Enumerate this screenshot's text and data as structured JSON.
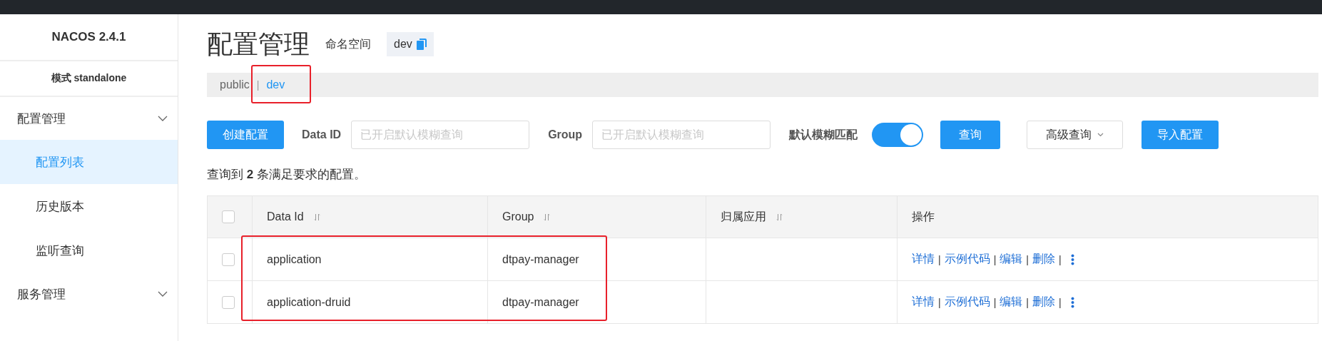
{
  "sidebar": {
    "title": "NACOS 2.4.1",
    "mode": "模式 standalone",
    "items": [
      {
        "label": "配置管理",
        "kind": "group",
        "children": [
          {
            "label": "配置列表",
            "selected": true
          },
          {
            "label": "历史版本",
            "selected": false
          },
          {
            "label": "监听查询",
            "selected": false
          }
        ]
      },
      {
        "label": "服务管理",
        "kind": "group"
      }
    ]
  },
  "header": {
    "title": "配置管理",
    "namespace_label": "命名空间",
    "namespace_value": "dev",
    "namespaces": [
      {
        "kind": "namespace",
        "text": "public",
        "selected": false
      },
      {
        "kind": "separator",
        "text": "|"
      },
      {
        "kind": "namespace",
        "text": "dev",
        "selected": true
      }
    ]
  },
  "toolbar": {
    "create_button": "创建配置",
    "data_id_label": "Data ID",
    "data_id_placeholder": "已开启默认模糊查询",
    "group_label": "Group",
    "group_placeholder": "已开启默认模糊查询",
    "fuzzy_label": "默认模糊匹配",
    "fuzzy_on": true,
    "query_button": "查询",
    "advanced_button": "高级查询",
    "import_button": "导入配置"
  },
  "summary": "查询到 **2** 条满足要求的配置。",
  "table": {
    "select_all_checked": false,
    "columns": [
      {
        "label": "Data Id",
        "sortable": true
      },
      {
        "label": "Group",
        "sortable": true
      },
      {
        "label": "归属应用",
        "sortable": true
      },
      {
        "label": "操作",
        "sortable": false
      }
    ],
    "rows": [
      {
        "checked": false,
        "data_id": "application",
        "group": "dtpay-manager",
        "actions": [
          {
            "kind": "link",
            "text": "详情"
          },
          {
            "kind": "separator",
            "text": "|"
          },
          {
            "kind": "link",
            "text": "示例代码"
          },
          {
            "kind": "separator",
            "text": "|"
          },
          {
            "kind": "link",
            "text": "编辑"
          },
          {
            "kind": "separator",
            "text": "|"
          },
          {
            "kind": "link",
            "text": "删除"
          },
          {
            "kind": "separator",
            "text": "|"
          },
          {
            "kind": "more"
          }
        ]
      },
      {
        "checked": false,
        "data_id": "application-druid",
        "group": "dtpay-manager",
        "actions": [
          {
            "kind": "link",
            "text": "详情"
          },
          {
            "kind": "separator",
            "text": "|"
          },
          {
            "kind": "link",
            "text": "示例代码"
          },
          {
            "kind": "separator",
            "text": "|"
          },
          {
            "kind": "link",
            "text": "编辑"
          },
          {
            "kind": "separator",
            "text": "|"
          },
          {
            "kind": "link",
            "text": "删除"
          },
          {
            "kind": "separator",
            "text": "|"
          },
          {
            "kind": "more"
          }
        ]
      }
    ]
  }
}
